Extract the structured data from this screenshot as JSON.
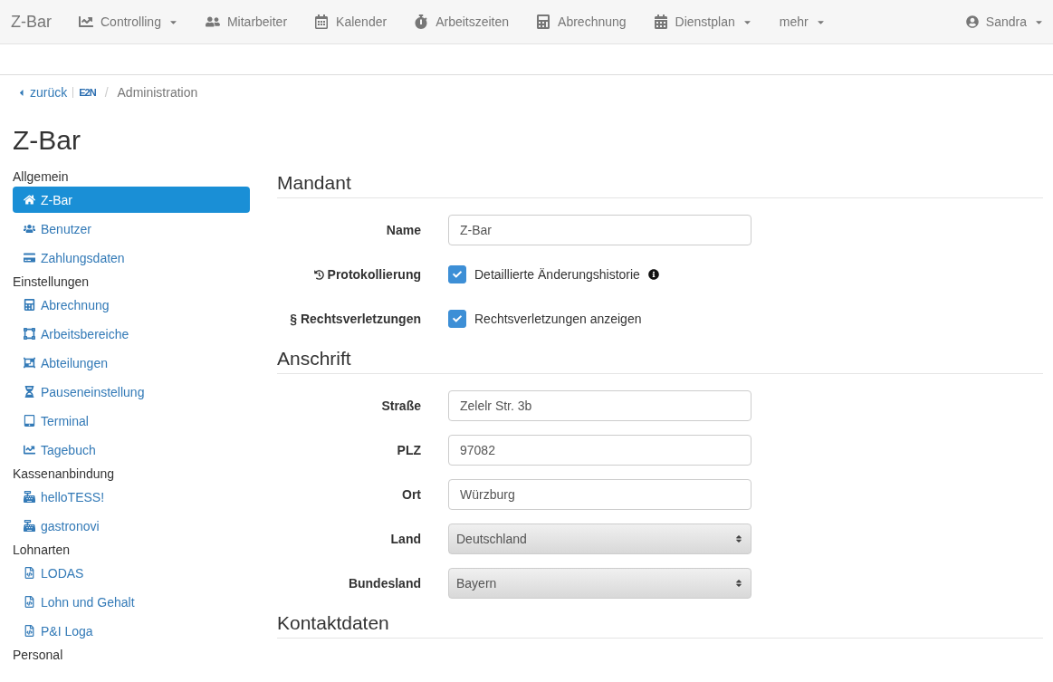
{
  "navbar": {
    "brand": "Z-Bar",
    "items": [
      {
        "label": "Controlling",
        "dropdown": true
      },
      {
        "label": "Mitarbeiter",
        "dropdown": false
      },
      {
        "label": "Kalender",
        "dropdown": false
      },
      {
        "label": "Arbeitszeiten",
        "dropdown": false
      },
      {
        "label": "Abrechnung",
        "dropdown": false
      },
      {
        "label": "Dienstplan",
        "dropdown": true
      },
      {
        "label": "mehr",
        "dropdown": true
      }
    ],
    "user": {
      "name": "Sandra",
      "dropdown": true
    }
  },
  "breadcrumb": {
    "back": "zurück",
    "logo": "E2N",
    "separator": "/",
    "current": "Administration"
  },
  "title": "Z-Bar",
  "sidebar": {
    "groups": [
      {
        "heading": "Allgemein",
        "items": [
          {
            "label": "Z-Bar",
            "selected": true
          },
          {
            "label": "Benutzer",
            "selected": false
          },
          {
            "label": "Zahlungsdaten",
            "selected": false
          }
        ]
      },
      {
        "heading": "Einstellungen",
        "items": [
          {
            "label": "Abrechnung",
            "selected": false
          },
          {
            "label": "Arbeitsbereiche",
            "selected": false
          },
          {
            "label": "Abteilungen",
            "selected": false
          },
          {
            "label": "Pauseneinstellung",
            "selected": false
          },
          {
            "label": "Terminal",
            "selected": false
          },
          {
            "label": "Tagebuch",
            "selected": false
          }
        ]
      },
      {
        "heading": "Kassenanbindung",
        "items": [
          {
            "label": "helloTESS!",
            "selected": false
          },
          {
            "label": "gastronovi",
            "selected": false
          }
        ]
      },
      {
        "heading": "Lohnarten",
        "items": [
          {
            "label": "LODAS",
            "selected": false
          },
          {
            "label": "Lohn und Gehalt",
            "selected": false
          },
          {
            "label": "P&I Loga",
            "selected": false
          }
        ]
      },
      {
        "heading": "Personal"
      }
    ]
  },
  "sections": [
    {
      "title": "Mandant",
      "fields": [
        {
          "kind": "text",
          "label": "Name",
          "value": "Z-Bar"
        },
        {
          "kind": "checkbox",
          "label": "Protokollierung",
          "text": "Detaillierte Änderungshistorie",
          "checked": true,
          "info": true
        },
        {
          "kind": "checkbox",
          "label": "§ Rechtsverletzungen",
          "text": "Rechtsverletzungen anzeigen",
          "checked": true,
          "info": false
        }
      ]
    },
    {
      "title": "Anschrift",
      "fields": [
        {
          "kind": "text",
          "label": "Straße",
          "value": "Zelelr Str. 3b"
        },
        {
          "kind": "text",
          "label": "PLZ",
          "value": "97082"
        },
        {
          "kind": "text",
          "label": "Ort",
          "value": "Würzburg"
        },
        {
          "kind": "select",
          "label": "Land",
          "value": "Deutschland"
        },
        {
          "kind": "select",
          "label": "Bundesland",
          "value": "Bayern"
        }
      ]
    },
    {
      "title": "Kontaktdaten"
    }
  ]
}
